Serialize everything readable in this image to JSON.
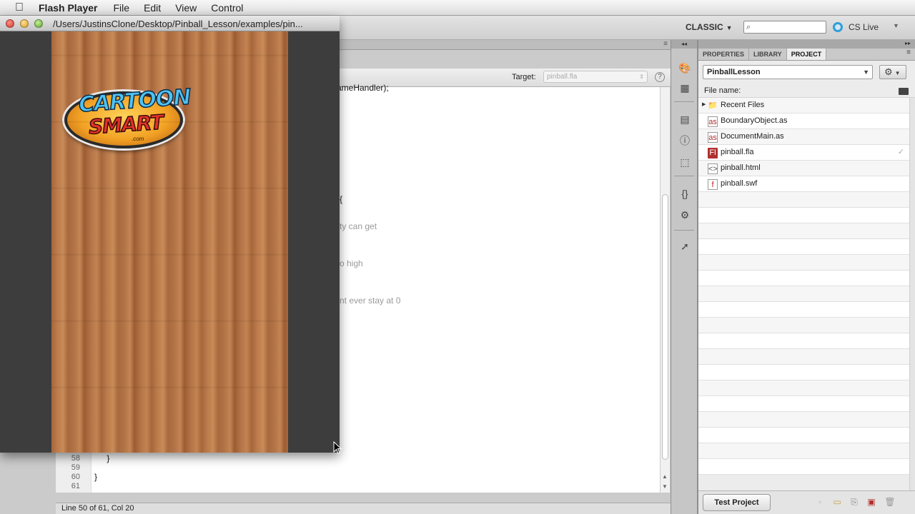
{
  "menubar": {
    "app_name": "Flash Player",
    "items": [
      "File",
      "Edit",
      "View",
      "Control"
    ]
  },
  "appbar": {
    "workspace": "CLASSIC",
    "search_placeholder": "",
    "cslive": "CS Live"
  },
  "flash_player": {
    "title": "/Users/JustinsClone/Desktop/Pinball_Lesson/examples/pin...",
    "logo": {
      "line1": "CARTOON",
      "line2": "SMART",
      "line3": ".com"
    }
  },
  "editor": {
    "target_label": "Target:",
    "target_value": "pinball.fla",
    "visible_code": [
      {
        "text": "ameHandler);",
        "comment": false
      },
      {
        "text": "{",
        "comment": false
      },
      {
        "text": "ty can get",
        "comment": true
      },
      {
        "text": "o high",
        "comment": true
      },
      {
        "text": "nt ever stay at 0",
        "comment": true
      }
    ],
    "bottom_lines": [
      {
        "num": "58",
        "code": "    }"
      },
      {
        "num": "59",
        "code": ""
      },
      {
        "num": "60",
        "code": "}"
      },
      {
        "num": "61",
        "code": ""
      }
    ],
    "status": "Line 50 of 61, Col 20"
  },
  "panel": {
    "tabs": [
      "PROPERTIES",
      "LIBRARY",
      "PROJECT"
    ],
    "active_tab": "PROJECT",
    "project_name": "PinballLesson",
    "file_name_label": "File name:",
    "files": [
      {
        "name": "Recent Files",
        "type": "folder"
      },
      {
        "name": "BoundaryObject.as",
        "type": "as"
      },
      {
        "name": "DocumentMain.as",
        "type": "as"
      },
      {
        "name": "pinball.fla",
        "type": "fla"
      },
      {
        "name": "pinball.html",
        "type": "html"
      },
      {
        "name": "pinball.swf",
        "type": "swf"
      }
    ],
    "test_project_label": "Test Project"
  },
  "colors": {
    "stage_wood": "#b9794a",
    "cslive_accent": "#2f9ed8",
    "fla_icon": "#b03030"
  }
}
